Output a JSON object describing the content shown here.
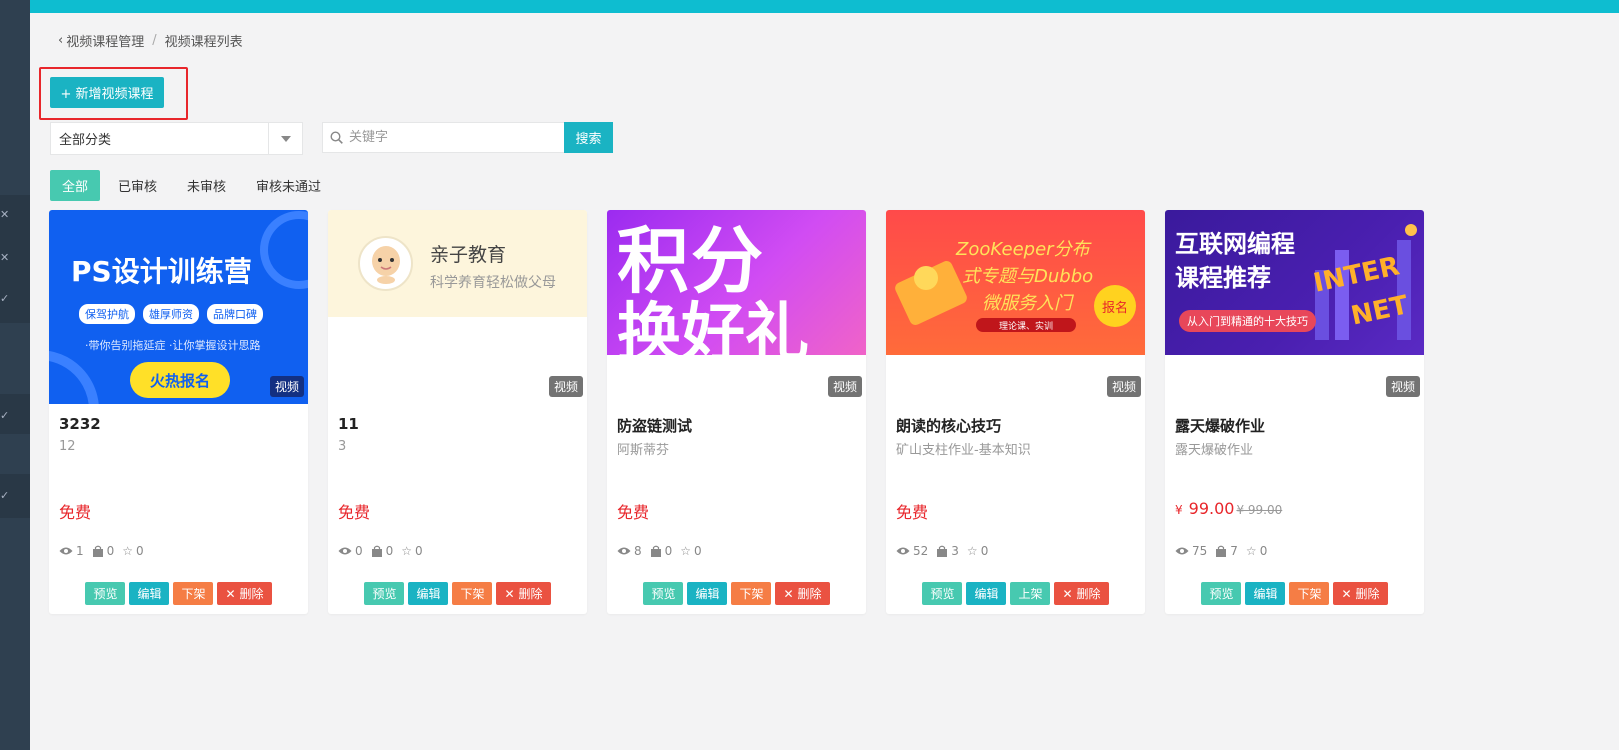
{
  "breadcrumb": {
    "back_icon": "chevron-left-icon",
    "parent": "视频课程管理",
    "separator": "/",
    "current": "视频课程列表"
  },
  "toolbar": {
    "add_label": "+ 新增视频课程"
  },
  "filters": {
    "category_value": "全部分类",
    "search_placeholder": "关键字",
    "search_label": "搜索"
  },
  "tabs": [
    {
      "label": "全部",
      "active": true
    },
    {
      "label": "已审核",
      "active": false
    },
    {
      "label": "未审核",
      "active": false
    },
    {
      "label": "审核未通过",
      "active": false
    }
  ],
  "cards": [
    {
      "cover": {
        "title": "PS设计训练营",
        "tags": [
          "保驾护航",
          "雄厚师资",
          "品牌口碑"
        ],
        "slogan": "·带你告别拖延症 ·让你掌握设计思路",
        "cta": "火热报名"
      },
      "type": "视频",
      "title": "3232",
      "sub": "12",
      "price": "免费",
      "stats": {
        "views": "1",
        "buys": "0",
        "stars": "0"
      },
      "actions": [
        "预览",
        "编辑",
        "下架",
        "删除"
      ]
    },
    {
      "cover": {
        "title": "亲子教育",
        "subtitle": "科学养育轻松做父母"
      },
      "type": "视频",
      "title": "11",
      "sub": "3",
      "price": "免费",
      "stats": {
        "views": "0",
        "buys": "0",
        "stars": "0"
      },
      "actions": [
        "预览",
        "编辑",
        "下架",
        "删除"
      ]
    },
    {
      "cover": {
        "line1": "积分",
        "line2": "换好礼"
      },
      "type": "视频",
      "title": "防盗链测试",
      "sub": "阿斯蒂芬",
      "price": "免费",
      "stats": {
        "views": "8",
        "buys": "0",
        "stars": "0"
      },
      "actions": [
        "预览",
        "编辑",
        "下架",
        "删除"
      ]
    },
    {
      "cover": {
        "line1": "ZooKeeper分布",
        "line2": "式专题与Dubbo",
        "line3": "微服务入门",
        "badge": "报名",
        "footer": "理论课、实训"
      },
      "type": "视频",
      "title": "朗读的核心技巧",
      "sub": "矿山支柱作业-基本知识",
      "price": "免费",
      "stats": {
        "views": "52",
        "buys": "3",
        "stars": "0"
      },
      "actions": [
        "预览",
        "编辑",
        "上架",
        "删除"
      ]
    },
    {
      "cover": {
        "line1": "互联网编程",
        "line2": "课程推荐",
        "pill": "从入门到精通的十大技巧",
        "art1": "INTER",
        "art2": "NET"
      },
      "type": "视频",
      "title": "露天爆破作业",
      "sub": "露天爆破作业",
      "price_symbol": "¥",
      "price": "99.00",
      "price_original": "¥ 99.00",
      "stats": {
        "views": "75",
        "buys": "7",
        "stars": "0"
      },
      "actions": [
        "预览",
        "编辑",
        "下架",
        "删除"
      ]
    }
  ],
  "icons": {
    "views": "eye-icon",
    "buys": "bag-icon",
    "stars": "star-icon",
    "delete": "close-icon",
    "search": "search-icon",
    "dropdown": "caret-down-icon"
  },
  "colors": {
    "accent": "#1ab3c3",
    "topbar": "#0ebdd0",
    "active_tab": "#47c9b0",
    "price": "#e8262b",
    "highlight": "#e8262b"
  }
}
